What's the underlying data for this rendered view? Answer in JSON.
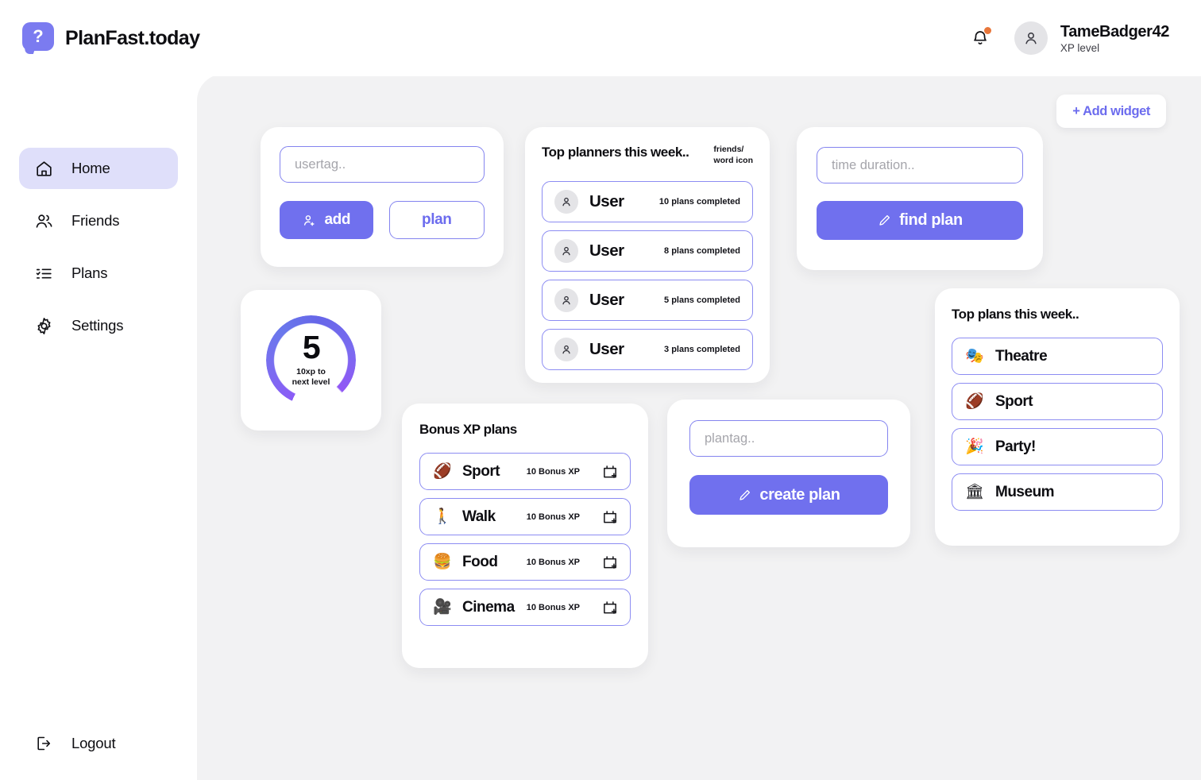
{
  "brand": {
    "name": "PlanFast.today",
    "logo_icon": "speech-bubble-question-icon",
    "logo_glyph": "?"
  },
  "header": {
    "notification_icon": "bell-icon",
    "has_notification": true,
    "notification_dot_color": "#e8763a",
    "avatar_icon": "person-icon",
    "user_name": "TameBadger42",
    "user_subtitle": "XP level"
  },
  "sidebar": {
    "items": [
      {
        "label": "Home",
        "icon": "home-icon",
        "active": true
      },
      {
        "label": "Friends",
        "icon": "people-icon",
        "active": false
      },
      {
        "label": "Plans",
        "icon": "checklist-icon",
        "active": false
      },
      {
        "label": "Settings",
        "icon": "gear-icon",
        "active": false
      }
    ],
    "logout": {
      "label": "Logout",
      "icon": "sign-out-icon"
    }
  },
  "toolbar": {
    "add_widget_label": "+ Add widget"
  },
  "widgets": {
    "add_friend": {
      "input_placeholder": "usertag..",
      "input_value": "",
      "add_label": "add",
      "add_icon": "person-plus-icon",
      "plan_label": "plan"
    },
    "xp": {
      "level": "5",
      "sub_line": "10xp to\nnext level",
      "progress_percent": 81,
      "ring_color_start": "#8b5cf6",
      "ring_color_end": "#6666e8"
    },
    "top_planners": {
      "title": "Top planners this week..",
      "note": "friends/\nword icon",
      "rows": [
        {
          "name": "User",
          "meta": "10 plans completed",
          "avatar_icon": "person-icon"
        },
        {
          "name": "User",
          "meta": "8 plans completed",
          "avatar_icon": "person-icon"
        },
        {
          "name": "User",
          "meta": "5 plans completed",
          "avatar_icon": "person-icon"
        },
        {
          "name": "User",
          "meta": "3 plans completed",
          "avatar_icon": "person-icon"
        }
      ]
    },
    "find_plan": {
      "input_placeholder": "time duration..",
      "input_value": "",
      "button_label": "find plan",
      "button_icon": "pencil-icon"
    },
    "top_plans": {
      "title": "Top plans this week..",
      "rows": [
        {
          "label": "Theatre",
          "emoji": "🎭"
        },
        {
          "label": "Sport",
          "emoji": "🏈"
        },
        {
          "label": "Party!",
          "emoji": "🎉"
        },
        {
          "label": "Museum",
          "emoji": "🏛"
        }
      ]
    },
    "bonus_xp": {
      "title": "Bonus XP plans",
      "rows": [
        {
          "label": "Sport",
          "emoji": "🏈",
          "meta": "10 Bonus XP",
          "action_icon": "calendar-plus-icon"
        },
        {
          "label": "Walk",
          "emoji": "🚶",
          "meta": "10 Bonus XP",
          "action_icon": "calendar-plus-icon"
        },
        {
          "label": "Food",
          "emoji": "🍔",
          "meta": "10 Bonus XP",
          "action_icon": "calendar-plus-icon"
        },
        {
          "label": "Cinema",
          "emoji": "🎥",
          "meta": "10 Bonus XP",
          "action_icon": "calendar-plus-icon"
        }
      ]
    },
    "create_plan": {
      "input_placeholder": "plantag..",
      "input_value": "",
      "button_label": "create plan",
      "button_icon": "pencil-icon"
    }
  },
  "theme": {
    "accent": "#7070ee",
    "accent_soft": "#dfdffa",
    "canvas_bg": "#f2f2f3",
    "border": "#8c8cf2"
  }
}
